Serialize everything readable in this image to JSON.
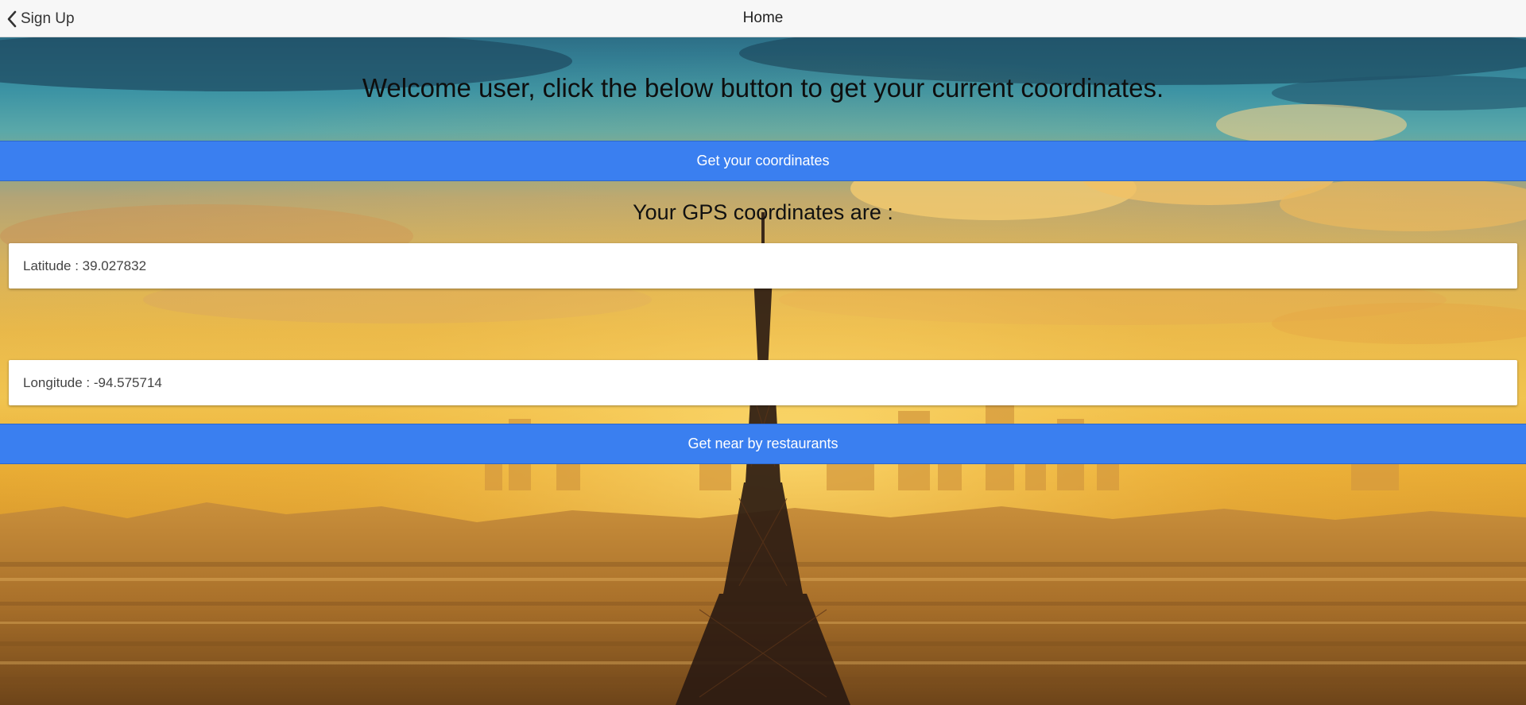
{
  "header": {
    "back_label": "Sign Up",
    "title": "Home"
  },
  "main": {
    "welcome_text": "Welcome user, click the below button to get your current coordinates.",
    "get_coordinates_button": "Get your coordinates",
    "gps_heading": "Your GPS coordinates are :",
    "latitude_text": "Latitude : 39.027832",
    "longitude_text": "Longitude : -94.575714",
    "restaurants_button": "Get near by restaurants"
  },
  "colors": {
    "accent": "#3a7ff0",
    "navbar": "#f7f7f7"
  },
  "icons": {
    "back": "chevron-left-icon"
  }
}
